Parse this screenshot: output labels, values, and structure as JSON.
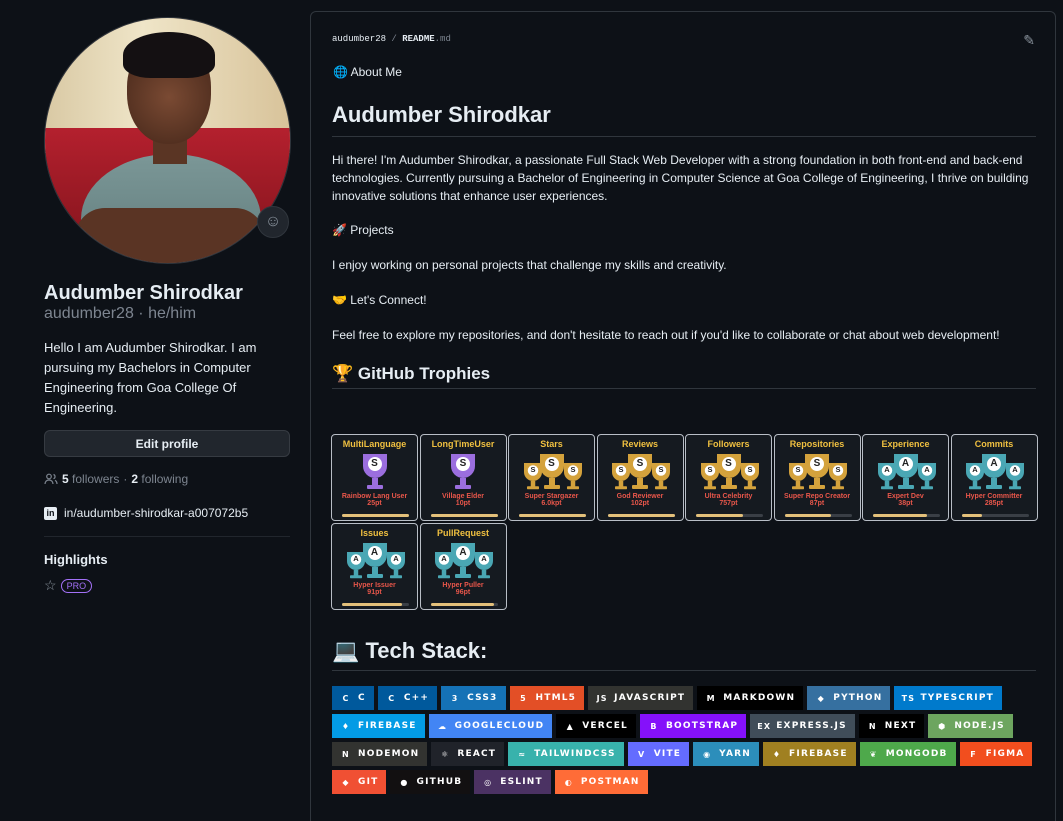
{
  "profile": {
    "name": "Audumber Shirodkar",
    "login": "audumber28",
    "pronouns": "he/him",
    "login_line": "audumber28 · he/him",
    "bio": "Hello I am Audumber Shirodkar. I am pursuing my Bachelors in Computer Engineering from Goa College Of Engineering.",
    "edit_label": "Edit profile",
    "followers_count": "5",
    "followers_label": "followers",
    "following_count": "2",
    "following_label": "following",
    "linkedin": "in/audumber-shirodkar-a007072b5",
    "highlights_title": "Highlights",
    "pro_label": "PRO"
  },
  "readme": {
    "crumb_user": "audumber28",
    "crumb_sep": "/",
    "crumb_file": "README",
    "crumb_ext": ".md",
    "about_label": "🌐 About Me",
    "heading": "Audumber Shirodkar",
    "intro": "Hi there! I'm Audumber Shirodkar, a passionate Full Stack Web Developer with a strong foundation in both front-end and back-end technologies. Currently pursuing a Bachelor of Engineering in Computer Science at Goa College of Engineering, I thrive on building innovative solutions that enhance user experiences.",
    "projects_label": "🚀 Projects",
    "projects_text": "I enjoy working on personal projects that challenge my skills and creativity.",
    "connect_label": "🤝 Let's Connect!",
    "connect_text": "Feel free to explore my repositories, and don't hesitate to reach out if you'd like to collaborate or chat about web development!",
    "trophies_heading": "🏆 GitHub Trophies",
    "stack_heading": "💻 Tech Stack:"
  },
  "trophies": [
    {
      "title": "MultiLanguage",
      "rank": "S",
      "sub": "Rainbow Lang User",
      "pt": "25pt",
      "progress": 1.0,
      "color": "#9b6ede"
    },
    {
      "title": "LongTimeUser",
      "rank": "S",
      "sub": "Village Elder",
      "pt": "10pt",
      "progress": 1.0,
      "color": "#9b6ede"
    },
    {
      "title": "Stars",
      "rank": "S",
      "sub": "Super Stargazer",
      "pt": "6.0kpt",
      "progress": 1.0,
      "color": "#d4a23c"
    },
    {
      "title": "Reviews",
      "rank": "S",
      "sub": "God Reviewer",
      "pt": "102pt",
      "progress": 1.0,
      "color": "#d4a23c"
    },
    {
      "title": "Followers",
      "rank": "S",
      "sub": "Ultra Celebrity",
      "pt": "757pt",
      "progress": 0.7,
      "color": "#d4a23c"
    },
    {
      "title": "Repositories",
      "rank": "S",
      "sub": "Super Repo Creator",
      "pt": "87pt",
      "progress": 0.7,
      "color": "#d4a23c"
    },
    {
      "title": "Experience",
      "rank": "A",
      "sub": "Expert Dev",
      "pt": "38pt",
      "progress": 0.8,
      "color": "#4aa7b4"
    },
    {
      "title": "Commits",
      "rank": "A",
      "sub": "Hyper Committer",
      "pt": "285pt",
      "progress": 0.3,
      "color": "#4aa7b4"
    },
    {
      "title": "Issues",
      "rank": "A",
      "sub": "Hyper Issuer",
      "pt": "91pt",
      "progress": 0.9,
      "color": "#4aa7b4"
    },
    {
      "title": "PullRequest",
      "rank": "A",
      "sub": "Hyper Puller",
      "pt": "96pt",
      "progress": 0.95,
      "color": "#4aa7b4"
    }
  ],
  "badge_rows": [
    [
      {
        "label": "C",
        "bg": "#00599c",
        "icon": "c-icon",
        "glyph": "C"
      },
      {
        "label": "C++",
        "bg": "#00599c",
        "icon": "cpp-icon",
        "glyph": "C"
      },
      {
        "label": "CSS3",
        "bg": "#1572b6",
        "icon": "css3-icon",
        "glyph": "3"
      },
      {
        "label": "HTML5",
        "bg": "#e34f26",
        "icon": "html5-icon",
        "glyph": "5"
      },
      {
        "label": "JavaScript",
        "bg": "#323330",
        "icon": "javascript-icon",
        "glyph": "JS"
      },
      {
        "label": "Markdown",
        "bg": "#000000",
        "icon": "markdown-icon",
        "glyph": "M"
      },
      {
        "label": "Python",
        "bg": "#3670a0",
        "icon": "python-icon",
        "glyph": "◆"
      },
      {
        "label": "TypeScript",
        "bg": "#007acc",
        "icon": "typescript-icon",
        "glyph": "TS"
      }
    ],
    [
      {
        "label": "Firebase",
        "bg": "#039be5",
        "icon": "firebase-icon",
        "glyph": "♦"
      },
      {
        "label": "GoogleCloud",
        "bg": "#4285f4",
        "icon": "cloud-icon",
        "glyph": "☁"
      },
      {
        "label": "Vercel",
        "bg": "#000000",
        "icon": "vercel-icon",
        "glyph": "▲"
      },
      {
        "label": "Bootstrap",
        "bg": "#8511fa",
        "icon": "bootstrap-icon",
        "glyph": "B"
      },
      {
        "label": "Express.js",
        "bg": "#404d59",
        "icon": "express-icon",
        "glyph": "ex"
      },
      {
        "label": "Next",
        "bg": "#000000",
        "icon": "next-icon",
        "glyph": "N"
      },
      {
        "label": "Node.js",
        "bg": "#6da55f",
        "icon": "nodejs-icon",
        "glyph": "⬢"
      }
    ],
    [
      {
        "label": "Nodemon",
        "bg": "#323330",
        "icon": "nodemon-icon",
        "glyph": "N"
      },
      {
        "label": "React",
        "bg": "#20232a",
        "icon": "react-icon",
        "glyph": "⚛"
      },
      {
        "label": "TailwindCSS",
        "bg": "#38b2ac",
        "icon": "tailwind-icon",
        "glyph": "≈"
      },
      {
        "label": "Vite",
        "bg": "#646cff",
        "icon": "vite-icon",
        "glyph": "V"
      },
      {
        "label": "Yarn",
        "bg": "#2c8ebb",
        "icon": "yarn-icon",
        "glyph": "◉"
      },
      {
        "label": "Firebase",
        "bg": "#a08021",
        "icon": "firebase-icon",
        "glyph": "♦"
      },
      {
        "label": "MongoDB",
        "bg": "#4ea94b",
        "icon": "mongodb-icon",
        "glyph": "❦"
      },
      {
        "label": "Figma",
        "bg": "#f24e1e",
        "icon": "figma-icon",
        "glyph": "F"
      }
    ],
    [
      {
        "label": "Git",
        "bg": "#f05033",
        "icon": "git-icon",
        "glyph": "◆"
      },
      {
        "label": "GitHub",
        "bg": "#121011",
        "icon": "github-icon",
        "glyph": "●"
      },
      {
        "label": "ESLint",
        "bg": "#4b3263",
        "icon": "eslint-icon",
        "glyph": "◎"
      },
      {
        "label": "Postman",
        "bg": "#ff6c37",
        "icon": "postman-icon",
        "glyph": "◐"
      }
    ]
  ]
}
